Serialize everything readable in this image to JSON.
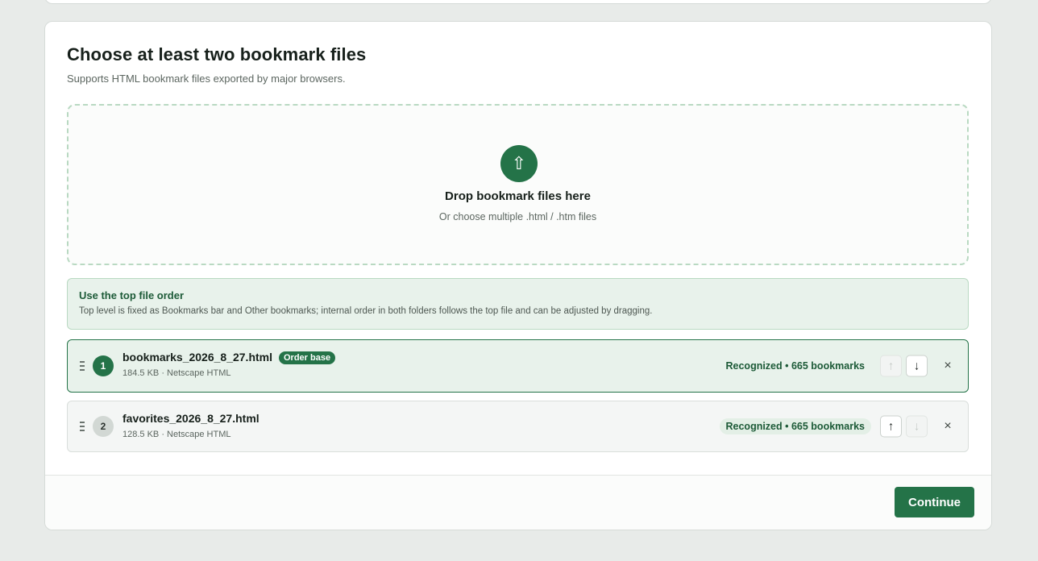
{
  "header": {
    "title": "Choose at least two bookmark files",
    "subtitle": "Supports HTML bookmark files exported by major browsers."
  },
  "dropzone": {
    "icon": "upload-arrow-icon",
    "title": "Drop bookmark files here",
    "hint": "Or choose multiple .html / .htm files"
  },
  "notice": {
    "title": "Use the top file order",
    "text": "Top level is fixed as Bookmarks bar and Other bookmarks; internal order in both folders follows the top file and can be adjusted by dragging."
  },
  "files": [
    {
      "order": "1",
      "name": "bookmarks_2026_8_27.html",
      "badge": "Order base",
      "meta": "184.5 KB · Netscape HTML",
      "status": "Recognized • 665 bookmarks",
      "up_enabled": false,
      "down_enabled": true
    },
    {
      "order": "2",
      "name": "favorites_2026_8_27.html",
      "meta": "128.5 KB · Netscape HTML",
      "status": "Recognized • 665 bookmarks",
      "up_enabled": true,
      "down_enabled": false
    }
  ],
  "icons": {
    "up": "↑",
    "down": "↓",
    "remove": "×",
    "upload": "⇧"
  },
  "footer": {
    "continue_label": "Continue"
  },
  "colors": {
    "accent": "#247348",
    "accent_light": "#e8f2eb",
    "background": "#e8ebe9"
  }
}
